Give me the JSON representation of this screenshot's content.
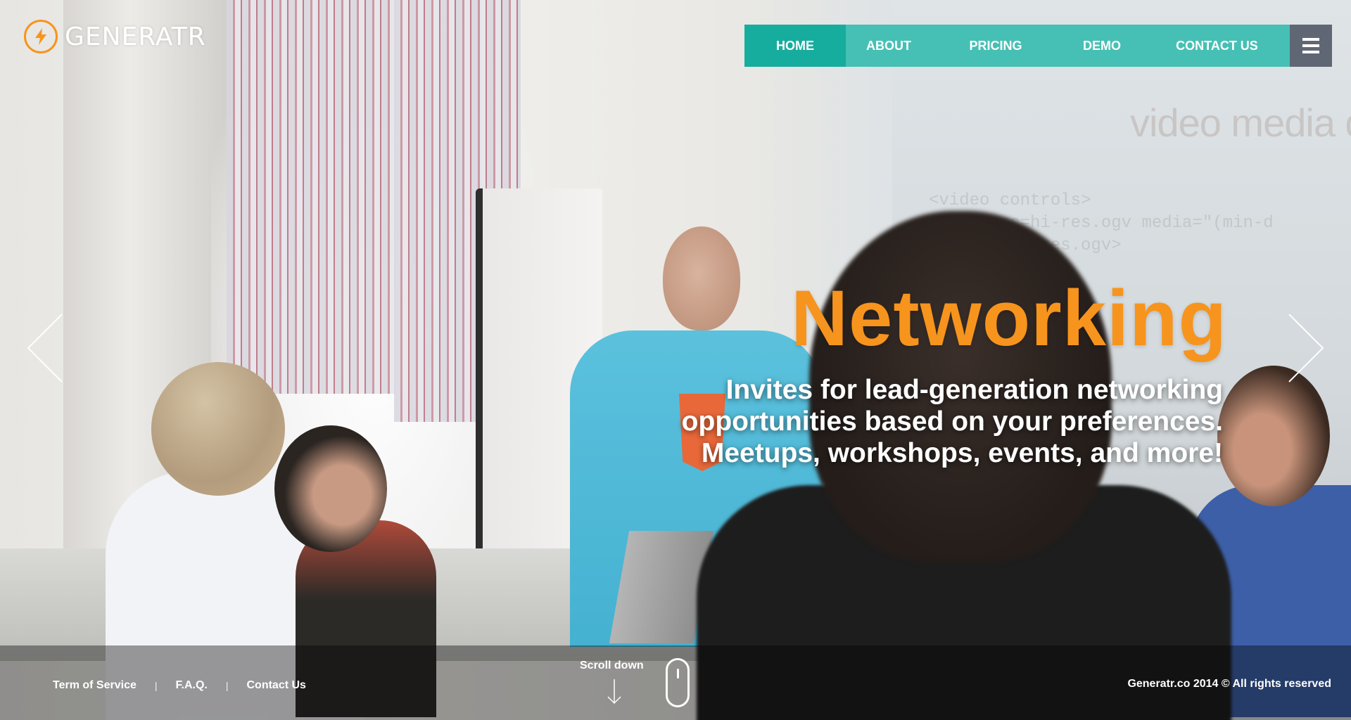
{
  "brand": {
    "logo_text": "GENERATR",
    "logo_icon": "lightning-bolt-icon",
    "accent_color": "#f7941d"
  },
  "nav": {
    "items": [
      {
        "label": "HOME",
        "active": true
      },
      {
        "label": "ABOUT",
        "active": false
      },
      {
        "label": "PRICING",
        "active": false
      },
      {
        "label": "DEMO",
        "active": false
      },
      {
        "label": "CONTACT US",
        "active": false
      }
    ],
    "menu_icon": "hamburger-menu-icon",
    "colors": {
      "active": "#17ad9e",
      "default": "#46c0b4",
      "menu": "#606774"
    }
  },
  "slide": {
    "title": "Networking",
    "subtitle": "Invites for lead-generation networking opportunities based on your preferences. Meetups, workshops, events, and more!",
    "prev_icon": "chevron-left-icon",
    "next_icon": "chevron-right-icon"
  },
  "background_text": {
    "projection_heading": "video media qu",
    "projection_code": "<video controls>\n      src=hi-res.ogv media=\"(min-d\n        lo-res.ogv>"
  },
  "footer": {
    "links": [
      "Term of Service",
      "F.A.Q.",
      "Contact Us"
    ],
    "separator": "|",
    "scroll_label": "Scroll down",
    "scroll_icon": "mouse-scroll-icon",
    "copyright": "Generatr.co 2014 © All rights reserved"
  }
}
